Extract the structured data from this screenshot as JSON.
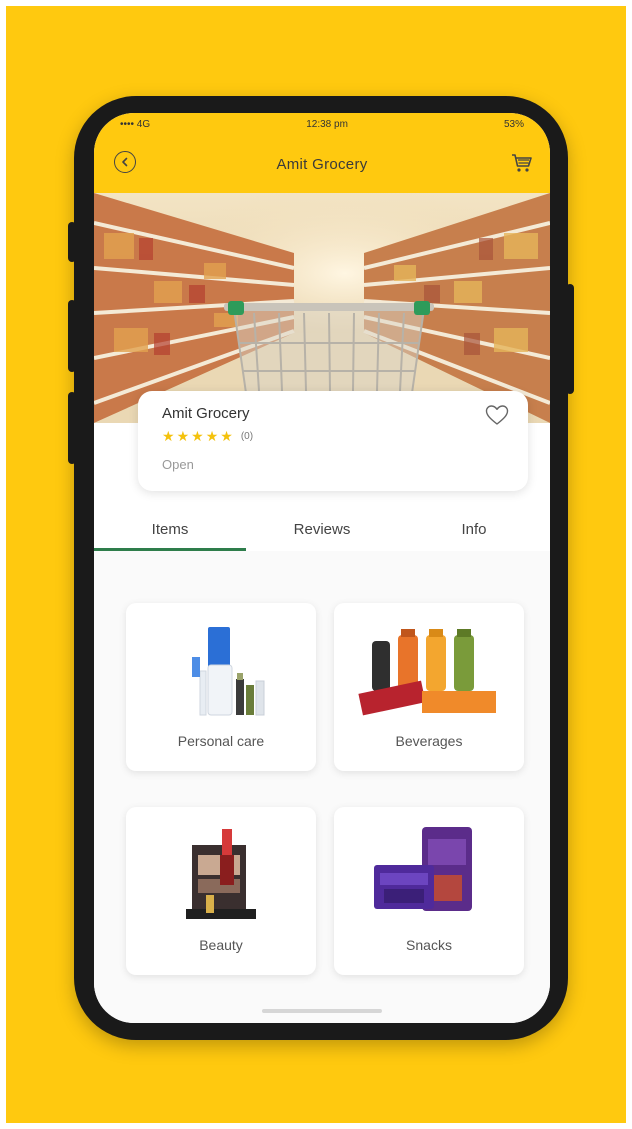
{
  "status_bar": {
    "carrier": "•••• 4G",
    "time": "12:38 pm",
    "battery": "53%"
  },
  "header": {
    "title": "Amit Grocery"
  },
  "store": {
    "name": "Amit Grocery",
    "rating": 5,
    "rating_count": "(0)",
    "status": "Open"
  },
  "tabs": [
    {
      "label": "Items",
      "active": true
    },
    {
      "label": "Reviews",
      "active": false
    },
    {
      "label": "Info",
      "active": false
    }
  ],
  "categories": [
    {
      "label": "Personal care"
    },
    {
      "label": "Beverages"
    },
    {
      "label": "Beauty"
    },
    {
      "label": "Snacks"
    }
  ],
  "colors": {
    "brand": "#FFC90F",
    "tab_indicator": "#2E7D4B",
    "star": "#F4C20D"
  },
  "icons": {
    "back": "back-arrow-icon",
    "cart": "cart-icon",
    "favorite": "heart-icon",
    "rating": "star-icon"
  }
}
